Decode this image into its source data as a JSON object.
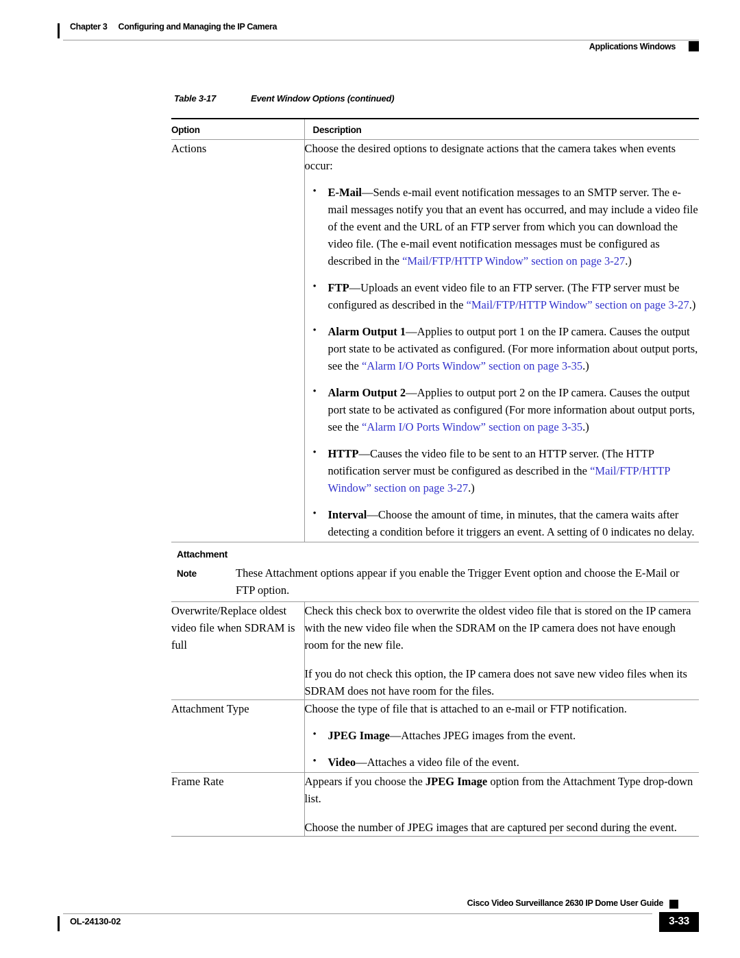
{
  "header": {
    "chapter_label": "Chapter 3",
    "chapter_title": "Configuring and Managing the IP Camera",
    "section_right": "Applications Windows"
  },
  "caption": {
    "number": "Table 3-17",
    "title": "Event Window Options (continued)"
  },
  "table": {
    "columns": {
      "option": "Option",
      "description": "Description"
    },
    "rows": {
      "actions": {
        "option": "Actions",
        "intro": "Choose the desired options to designate actions that the camera takes when events occur:",
        "bullets": [
          {
            "term": "E-Mail",
            "dash": "—",
            "text_1": "Sends e-mail event notification messages to an SMTP server. The e-mail messages notify you that an event has occurred, and may include a video file of the event and the URL of an FTP server from which you can download the video file. (The e-mail event notification messages must be configured as described in the ",
            "link": "“Mail/FTP/HTTP Window” section on page 3-27",
            "text_2": ".)"
          },
          {
            "term": "FTP",
            "dash": "—",
            "text_1": "Uploads an event video file to an FTP server. (The FTP server must be configured as described in the ",
            "link": "“Mail/FTP/HTTP Window” section on page 3-27",
            "text_2": ".)"
          },
          {
            "term": "Alarm Output 1",
            "dash": "—",
            "text_1": "Applies to output port 1 on the IP camera. Causes the output port state to be activated as configured. (For more information about output ports, see the ",
            "link": "“Alarm I/O Ports Window” section on page 3-35",
            "text_2": ".)"
          },
          {
            "term": "Alarm Output 2",
            "dash": "—",
            "text_1": "Applies to output port 2 on the IP camera. Causes the output port state to be activated as configured (For more information about output ports, see the ",
            "link": "“Alarm I/O Ports Window” section on page 3-35",
            "text_2": ".)"
          },
          {
            "term": "HTTP",
            "dash": "—",
            "text_1": "Causes the video file to be sent to an HTTP server. (The HTTP notification server must be configured as described in the ",
            "link": "“Mail/FTP/HTTP Window” section on page 3-27",
            "text_2": ".)"
          },
          {
            "term": "Interval",
            "dash": "—",
            "text_1": "Choose the amount of time, in minutes, that the camera waits after detecting a condition before it triggers an event. A setting of 0 indicates no delay.",
            "link": "",
            "text_2": ""
          }
        ]
      },
      "attachment_section": {
        "title": "Attachment",
        "note_label": "Note",
        "note_text": "These Attachment options appear if you enable the Trigger Event option and choose the E-Mail or FTP option."
      },
      "overwrite": {
        "option": "Overwrite/Replace oldest video file when SDRAM is full",
        "para_1": "Check this check box to overwrite the oldest video file that is stored on the IP camera with the new video file when the SDRAM on the IP camera does not have enough room for the new file.",
        "para_2": "If you do not check this option, the IP camera does not save new video files when its SDRAM does not have room for the files."
      },
      "attachment_type": {
        "option": "Attachment Type",
        "intro": "Choose the type of file that is attached to an e-mail or FTP notification.",
        "bullets": [
          {
            "term": "JPEG Image",
            "dash": "—",
            "text_1": "Attaches JPEG images from the event."
          },
          {
            "term": "Video",
            "dash": "—",
            "text_1": "Attaches a video file of the event."
          }
        ]
      },
      "frame_rate": {
        "option": "Frame Rate",
        "para_1_a": "Appears if you choose the ",
        "para_1_b": "JPEG Image",
        "para_1_c": " option from the Attachment Type drop-down list.",
        "para_2": "Choose the number of JPEG images that are captured per second during the event."
      }
    }
  },
  "footer": {
    "guide_title": "Cisco Video Surveillance 2630 IP Dome User Guide",
    "doc_id": "OL-24130-02",
    "page_number": "3-33"
  },
  "colors": {
    "link": "#3333CC",
    "rule": "#9A9A9A",
    "text": "#000000"
  }
}
